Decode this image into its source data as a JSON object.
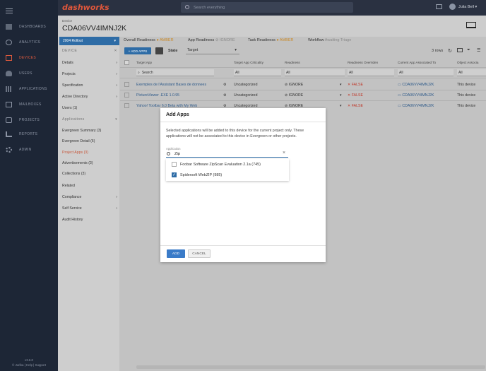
{
  "app": {
    "logo": "dashworks",
    "search_placeholder": "Search everything",
    "user_name": "Julia Bell ▾"
  },
  "nav": [
    {
      "label": "DASHBOARDS"
    },
    {
      "label": "ANALYTICS"
    },
    {
      "label": "DEVICES"
    },
    {
      "label": "USERS"
    },
    {
      "label": "APPLICATIONS"
    },
    {
      "label": "MAILBOXES"
    },
    {
      "label": "PROJECTS"
    },
    {
      "label": "REPORTS"
    },
    {
      "label": "ADMIN"
    }
  ],
  "footer": {
    "version": "v3.6.0",
    "links": "© Juriba | Help | Support"
  },
  "header": {
    "label": "Device",
    "title": "CDA06VV4IMNJ2K"
  },
  "side": {
    "project": "2004 Rollout",
    "section_device": "DEVICE",
    "items": [
      "Details",
      "Projects",
      "Specification",
      "Active Directory",
      "Users (1)"
    ],
    "section_apps": "Applications",
    "app_items": [
      "Evergreen Summary (3)",
      "Evergreen Detail (6)",
      "Project Apps (3)",
      "Advertisements (3)",
      "Collections (3)"
    ],
    "related": "Related",
    "tail_items": [
      "Compliance",
      "Self Service",
      "Audit History"
    ]
  },
  "tabs": {
    "overall": "Overall Readiness",
    "overall_val": "AMBER",
    "app": "App Readiness",
    "app_val": "IGNORE",
    "task": "Task Readiness",
    "task_val": "AMBER",
    "workflow": "Workflow",
    "workflow_val": "Awaiting Triage"
  },
  "toolbar": {
    "add_apps": "+ ADD APPS",
    "state": "State",
    "target": "Target",
    "rows": "3 rows"
  },
  "grid": {
    "headers": [
      "Target App",
      "Target App Criticality",
      "Readiness",
      "Readiness Overriden",
      "Current App Associated To",
      "Object Associa"
    ],
    "search_placeholder": "Search",
    "filter_all": "All",
    "rows": [
      {
        "app": "Exemples de l'Assistant Bases de donnees",
        "crit": "Uncategorized",
        "ready": "IGNORE",
        "over": "✕ FALSE",
        "assoc": "CDA06VV4IMNJ2K",
        "obj": "This device"
      },
      {
        "app": "PictureViewer .EXE 1.0.95",
        "crit": "Uncategorized",
        "ready": "IGNORE",
        "over": "✕ FALSE",
        "assoc": "CDA06VV4IMNJ2K",
        "obj": "This device"
      },
      {
        "app": "Yahoo! Toolbar 6.0 Beta with My Web",
        "crit": "Uncategorized",
        "ready": "IGNORE",
        "over": "✕ FALSE",
        "assoc": "CDA06VV4IMNJ2K",
        "obj": "This device"
      }
    ]
  },
  "modal": {
    "title": "Add Apps",
    "text": "Selected applications will be added to this device for the current project only. These applications will not be associated to this device in Evergreen or other projects.",
    "field_label": "Application",
    "field_value": "Zip",
    "options": [
      {
        "label": "Foobar Software ZipScan Evaluation 2.1a (745)",
        "checked": false
      },
      {
        "label": "Spidersoft WebZIP (985)",
        "checked": true
      }
    ],
    "add": "ADD",
    "cancel": "CANCEL"
  }
}
